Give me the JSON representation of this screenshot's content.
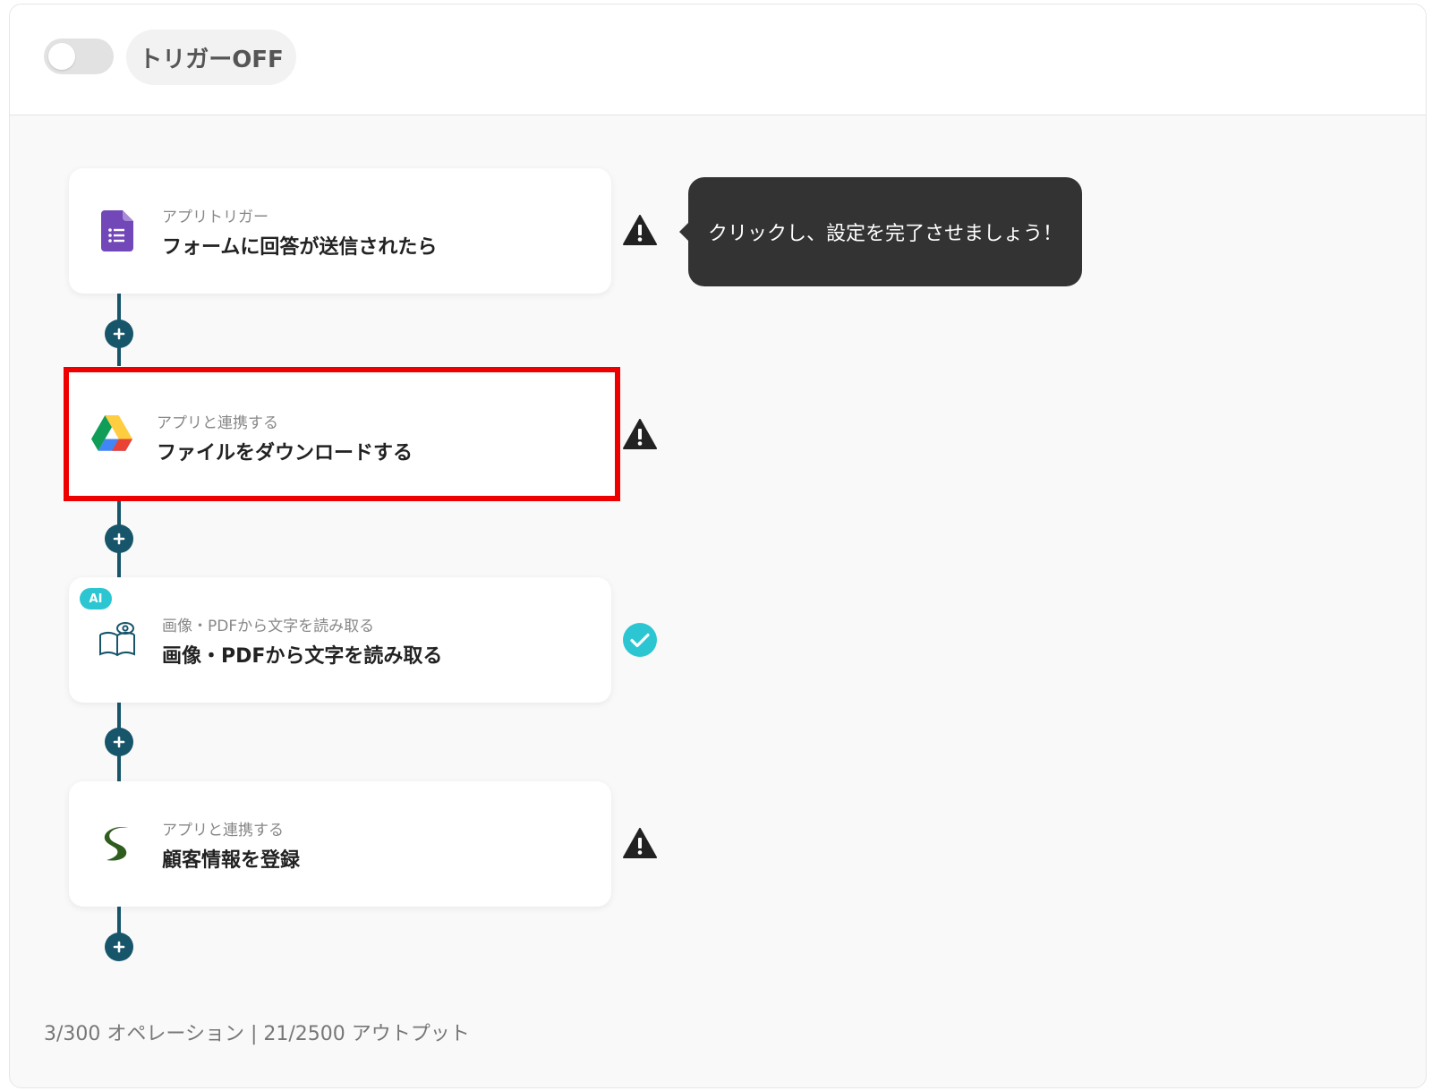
{
  "header": {
    "trigger_toggle_state": "off",
    "trigger_label": "トリガーOFF"
  },
  "tooltip": {
    "text": "クリックし、設定を完了させましょう！"
  },
  "steps": [
    {
      "subtitle": "アプリトリガー",
      "title": "フォームに回答が送信されたら",
      "icon": "google-forms-icon",
      "status": "warning"
    },
    {
      "subtitle": "アプリと連携する",
      "title": "ファイルをダウンロードする",
      "icon": "google-drive-icon",
      "status": "warning",
      "highlighted": true
    },
    {
      "badge": "AI",
      "subtitle": "画像・PDFから文字を読み取る",
      "title": "画像・PDFから文字を読み取る",
      "icon": "ocr-book-eye-icon",
      "status": "complete"
    },
    {
      "subtitle": "アプリと連携する",
      "title": "顧客情報を登録",
      "icon": "sansan-logo-icon",
      "status": "warning"
    }
  ],
  "footer": {
    "usage_text": "3/300 オペレーション | 21/2500 アウトプット"
  },
  "colors": {
    "connector": "#17556b",
    "highlight_border": "#ee0000",
    "check": "#2cc6d2",
    "tooltip_bg": "#333333"
  }
}
